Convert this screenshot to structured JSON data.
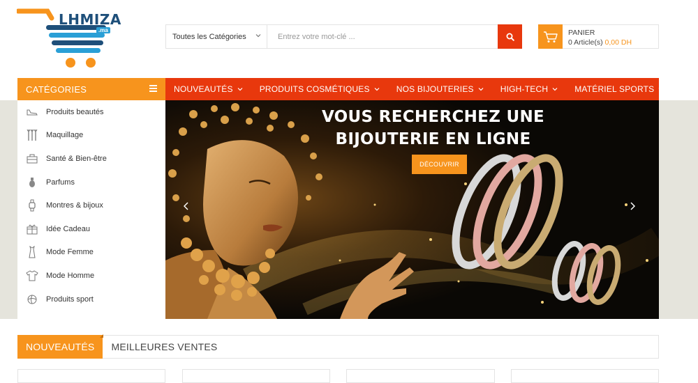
{
  "brand": {
    "name": "LHMIZA",
    "tld": ".ma",
    "colors": {
      "orange": "#f7941d",
      "red": "#e8380d",
      "navy": "#1e4f7a",
      "blue": "#2a9fd6"
    }
  },
  "search": {
    "category_label": "Toutes les Catégories",
    "placeholder": "Entrez votre mot-clé ...",
    "value": ""
  },
  "cart": {
    "title": "PANIER",
    "items_label": "0 Article(s)",
    "total": "0,00 DH"
  },
  "categories": {
    "title": "CATÉGORIES",
    "items": [
      {
        "label": "Produits beautés",
        "icon": "shoe-icon"
      },
      {
        "label": "Maquillage",
        "icon": "brushes-icon"
      },
      {
        "label": "Santé & Bien-être",
        "icon": "medkit-icon"
      },
      {
        "label": "Parfums",
        "icon": "perfume-icon"
      },
      {
        "label": "Montres & bijoux",
        "icon": "watch-icon"
      },
      {
        "label": "Idée Cadeau",
        "icon": "gift-icon"
      },
      {
        "label": "Mode Femme",
        "icon": "dress-icon"
      },
      {
        "label": "Mode Homme",
        "icon": "shirt-icon"
      },
      {
        "label": "Produits sport",
        "icon": "ball-icon"
      }
    ]
  },
  "nav": {
    "items": [
      {
        "label": "NOUVEAUTÉS"
      },
      {
        "label": "PRODUITS COSMÉTIQUES"
      },
      {
        "label": "NOS BIJOUTERIES"
      },
      {
        "label": "HIGH-TECH"
      },
      {
        "label": "MATÉRIEL SPORTS"
      }
    ]
  },
  "banner": {
    "line1": "VOUS RECHERCHEZ UNE",
    "line2": "BIJOUTERIE EN LIGNE",
    "button": "DÉCOUVRIR"
  },
  "tabs": {
    "items": [
      {
        "label": "NOUVEAUTÉS",
        "active": true
      },
      {
        "label": "MEILLEURES VENTES",
        "active": false
      }
    ]
  }
}
